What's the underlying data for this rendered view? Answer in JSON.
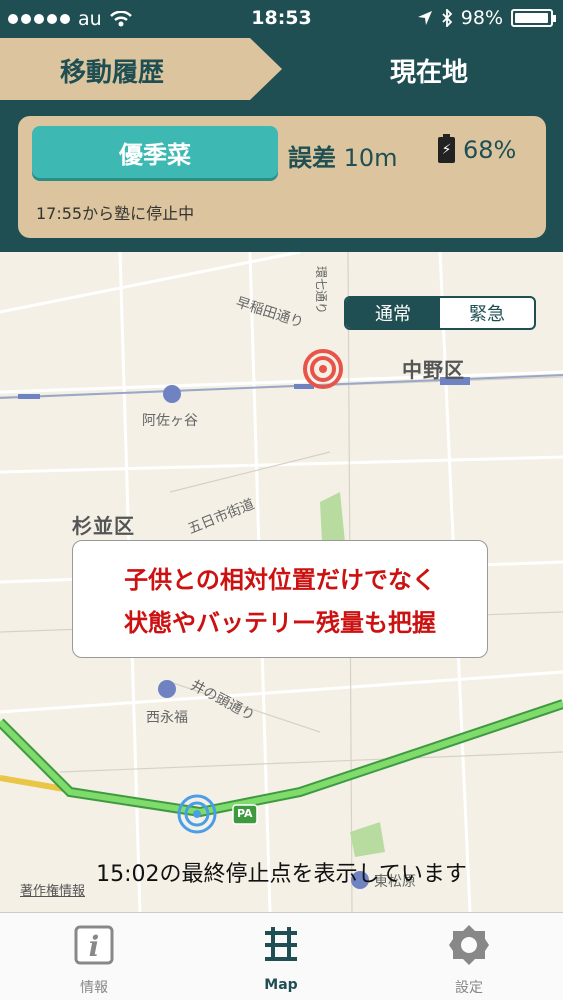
{
  "status_bar": {
    "carrier": "au",
    "time": "18:53",
    "battery": "98%",
    "battery_level": 0.98
  },
  "header": {
    "tab_history": "移動履歴",
    "tab_current": "現在地"
  },
  "panel": {
    "child_name": "優季菜",
    "error_label": "誤差",
    "error_value": "10m",
    "battery_pct": "68%",
    "status": "17:55から塾に停止中"
  },
  "map": {
    "mode_normal": "通常",
    "mode_emergency": "緊急",
    "labels": {
      "road_waseda": "早稲田通り",
      "station_asagaya": "阿佐ヶ谷",
      "ward_nakano": "中野区",
      "ward_suginami": "杉並区",
      "road_itsukaichi": "五日市街道",
      "road_inokashira": "井の頭通り",
      "station_nishieifuku": "西永福",
      "station_higashimatsubara": "東松原",
      "road_kannana": "環七通り",
      "pa_badge": "PA"
    },
    "callout_line1": "子供との相対位置だけでなく",
    "callout_line2": "状態やバッテリー残量も把握",
    "bottom_message": "15:02の最終停止点を表示しています",
    "copyright": "著作権情報"
  },
  "tabbar": {
    "info": "情報",
    "map": "Map",
    "settings": "設定"
  },
  "colors": {
    "header_teal": "#1f4f52",
    "beige": "#dcc59e",
    "name_button": "#3eb8b2",
    "callout_text": "#cc1111"
  }
}
